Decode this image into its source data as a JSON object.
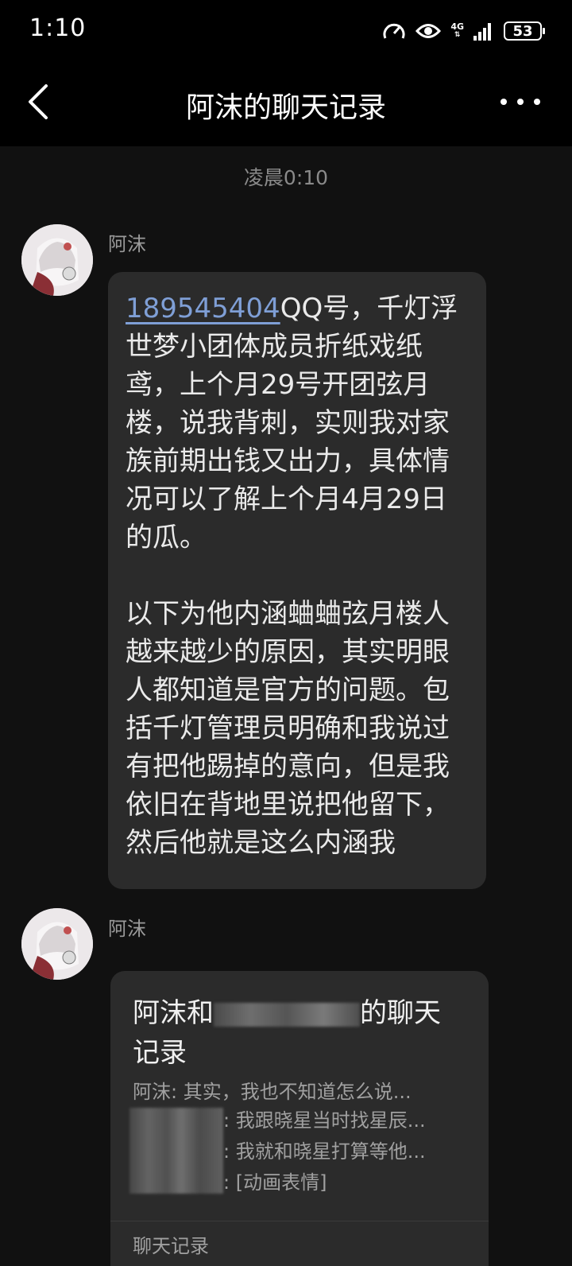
{
  "status_bar": {
    "time": "1:10",
    "network": "4G",
    "battery": "53"
  },
  "header": {
    "title": "阿沫的聊天记录"
  },
  "timestamp": "凌晨0:10",
  "messages": [
    {
      "sender": "阿沫",
      "qq_number": "189545404",
      "text": "QQ号，千灯浮世梦小团体成员折纸戏纸鸢，上个月29号开团弦月楼，说我背刺，实则我对家族前期出钱又出力，具体情况可以了解上个月4月29日的瓜。\n\n以下为他内涵蛐蛐弦月楼人越来越少的原因，其实明眼人都知道是官方的问题。包括千灯管理员明确和我说过有把他踢掉的意向，但是我依旧在背地里说把他留下，然后他就是这么内涵我"
    },
    {
      "sender": "阿沫",
      "card": {
        "title_start": "阿沫和",
        "title_end": "的聊天记录",
        "preview": [
          "阿沫: 其实，我也不知道怎么说...",
          ": 我跟晓星当时找星辰...",
          ": 我就和晓星打算等他...",
          ": [动画表情]"
        ],
        "footer": "聊天记录"
      }
    }
  ]
}
